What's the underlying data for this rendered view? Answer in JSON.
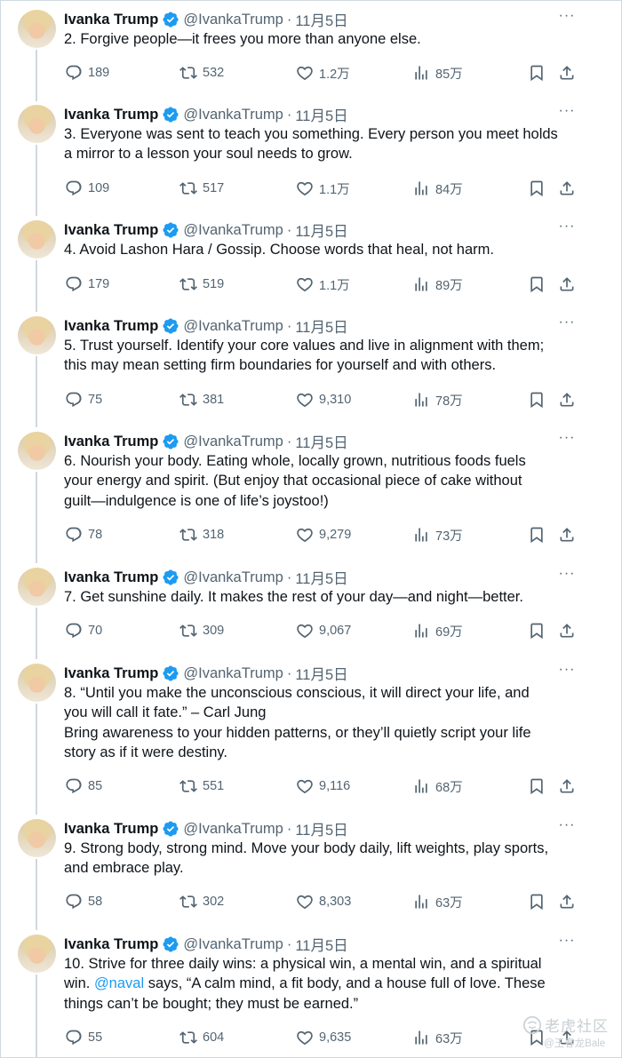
{
  "author": {
    "name": "Ivanka Trump",
    "handle": "@IvankaTrump",
    "date": "11月5日",
    "dot": "·",
    "more": "···"
  },
  "colors": {
    "text": "#0f1419",
    "secondary": "#536471",
    "accent": "#1d9bf0",
    "verified": "#1d9bf0",
    "thread_line": "#cfd9de"
  },
  "icons": {
    "reply": "speech-bubble-icon",
    "retweet": "retweet-icon",
    "like": "heart-icon",
    "views": "bar-chart-icon",
    "bookmark": "bookmark-icon",
    "share": "share-upload-icon",
    "verified": "verified-badge-icon",
    "more": "more-dots-icon"
  },
  "tweets": [
    {
      "text": "2. Forgive people—it frees you more than anyone else.",
      "replies": "189",
      "retweets": "532",
      "likes": "1.2万",
      "views": "85万"
    },
    {
      "text": "3. Everyone was sent to teach you something. Every person you meet holds\na mirror to a lesson your soul needs to grow.",
      "replies": "109",
      "retweets": "517",
      "likes": "1.1万",
      "views": "84万"
    },
    {
      "text": "4. Avoid Lashon Hara / Gossip. Choose words that heal, not harm.",
      "replies": "179",
      "retweets": "519",
      "likes": "1.1万",
      "views": "89万"
    },
    {
      "text": "5. Trust yourself. Identify your core values and live in alignment with them;\nthis may mean setting firm boundaries for yourself and with others.",
      "replies": "75",
      "retweets": "381",
      "likes": "9,310",
      "views": "78万"
    },
    {
      "text": "6. Nourish your body. Eating whole, locally grown, nutritious foods fuels\nyour energy and spirit. (But enjoy that occasional piece of cake without\nguilt—indulgence is one of life’s joystoo!)",
      "replies": "78",
      "retweets": "318",
      "likes": "9,279",
      "views": "73万"
    },
    {
      "text": "7. Get sunshine daily. It makes the rest of your day—and night—better.",
      "replies": "70",
      "retweets": "309",
      "likes": "9,067",
      "views": "69万"
    },
    {
      "text": "8. “Until you make the unconscious conscious, it will direct your life, and\nyou will call it fate.” – Carl Jung\nBring awareness to your hidden patterns, or they’ll quietly script your life\nstory as if it were destiny.",
      "replies": "85",
      "retweets": "551",
      "likes": "9,116",
      "views": "68万"
    },
    {
      "text": "9. Strong body, strong mind. Move your body daily, lift weights, play sports,\nand embrace play.",
      "replies": "58",
      "retweets": "302",
      "likes": "8,303",
      "views": "63万"
    },
    {
      "text_before_mention": "10. Strive for three daily wins: a physical win, a mental win, and a spiritual\nwin. ",
      "mention": "@naval",
      "text_after_mention": " says, “A calm mind, a fit body, and a house full of love. These\nthings can’t be bought; they must be earned.”",
      "replies": "55",
      "retweets": "604",
      "likes": "9,635",
      "views": "63万"
    }
  ],
  "watermark": {
    "title": "老虎社区",
    "user": "@王春龙Bale"
  }
}
